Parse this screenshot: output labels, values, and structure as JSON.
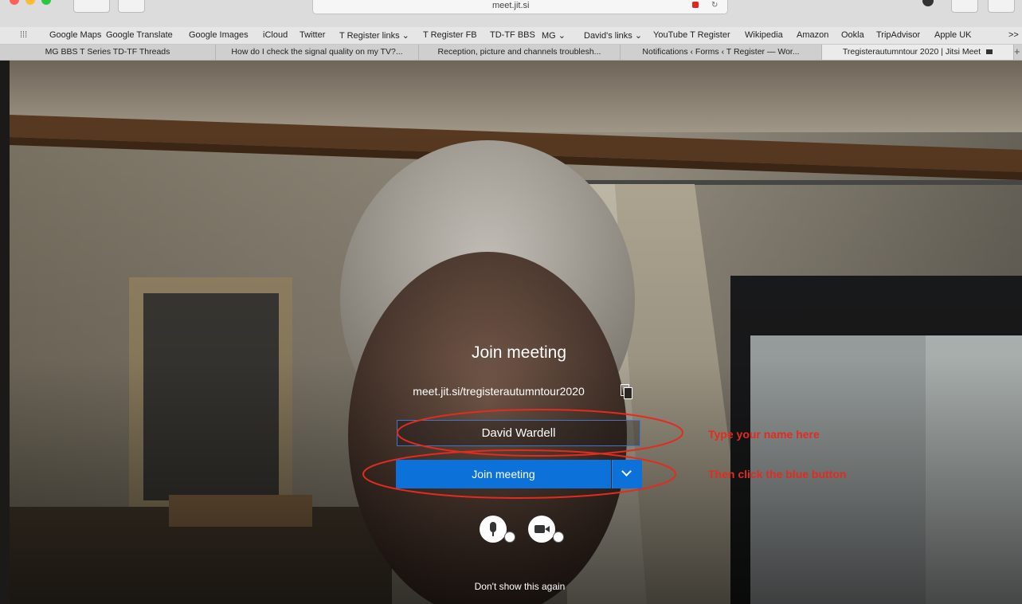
{
  "browser": {
    "url": "meet.jit.si"
  },
  "bookmarks": [
    "Google Maps",
    "Google Translate",
    "Google Images",
    "iCloud",
    "Twitter",
    "T Register links ⌄",
    "T Register FB",
    "TD-TF BBS",
    "MG ⌄",
    "David's links ⌄",
    "YouTube T Register",
    "Wikipedia",
    "Amazon",
    "Ookla",
    "TripAdvisor",
    "Apple UK"
  ],
  "bookmarks_more": ">>",
  "tabs": [
    "MG BBS T Series TD-TF Threads",
    "How do I check the signal quality on my TV?...",
    "Reception, picture and channels troublesh...",
    "Notifications ‹ Forms ‹ T Register — Wor...",
    "Tregisterautumntour 2020 | Jitsi Meet"
  ],
  "new_tab": "+",
  "meeting": {
    "title": "Join meeting",
    "url": "meet.jit.si/tregisterautumntour2020",
    "name_value": "David Wardell",
    "join_label": "Join meeting",
    "dont_show": "Don't show this again"
  },
  "annotations": {
    "type_name": "Type your name here",
    "click_blue": "Then click the blue button"
  },
  "colors": {
    "join_button": "#0c72d9",
    "annotation": "#e32b1e"
  }
}
